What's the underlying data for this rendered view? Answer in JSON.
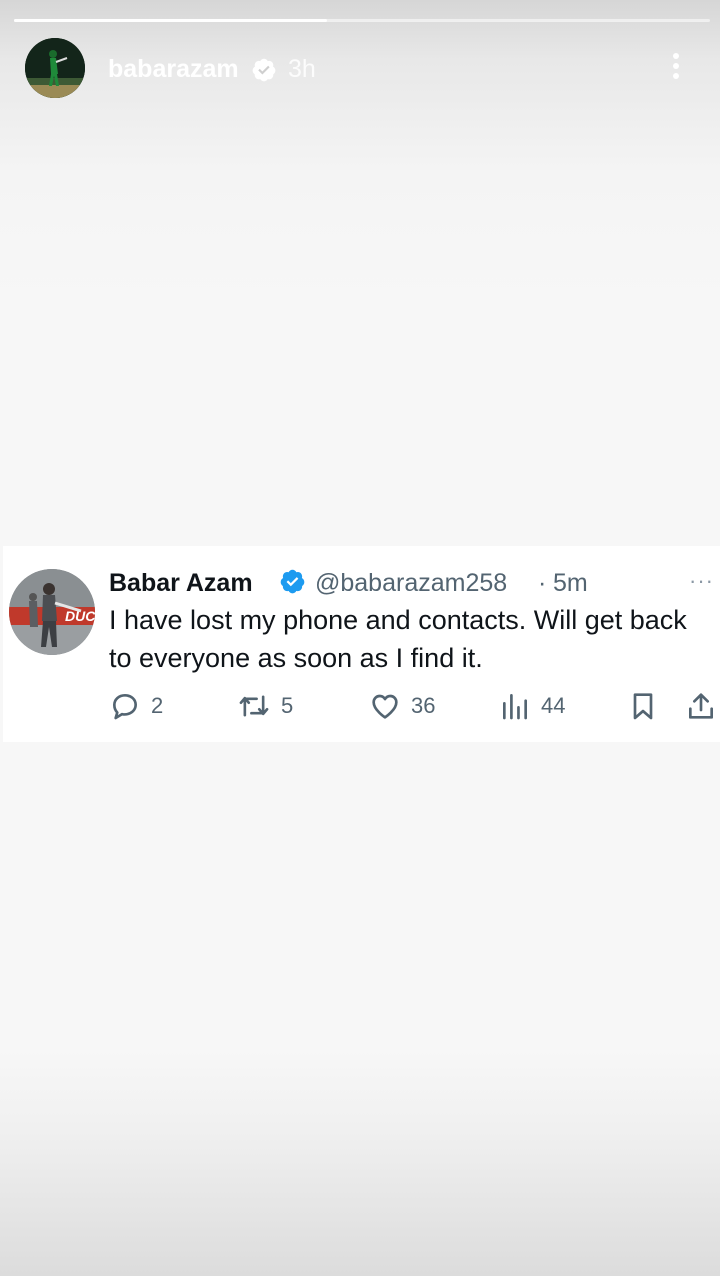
{
  "story": {
    "progress": 0.45,
    "username": "babarazam",
    "time": "3h"
  },
  "tweet": {
    "name": "Babar Azam",
    "handle": "@babarazam258",
    "separator": "·",
    "time": "5m",
    "more": "···",
    "text": "I have lost my phone and contacts. Will get back to everyone as soon as I find it.",
    "actions": {
      "replies": "2",
      "retweets": "5",
      "likes": "36",
      "views": "44"
    }
  },
  "colors": {
    "verified": "#1d9bf0",
    "text_secondary": "#536471"
  },
  "icons": [
    "verified-badge-icon",
    "more-vertical-icon",
    "reply-icon",
    "retweet-icon",
    "like-icon",
    "views-icon",
    "bookmark-icon",
    "share-icon"
  ]
}
